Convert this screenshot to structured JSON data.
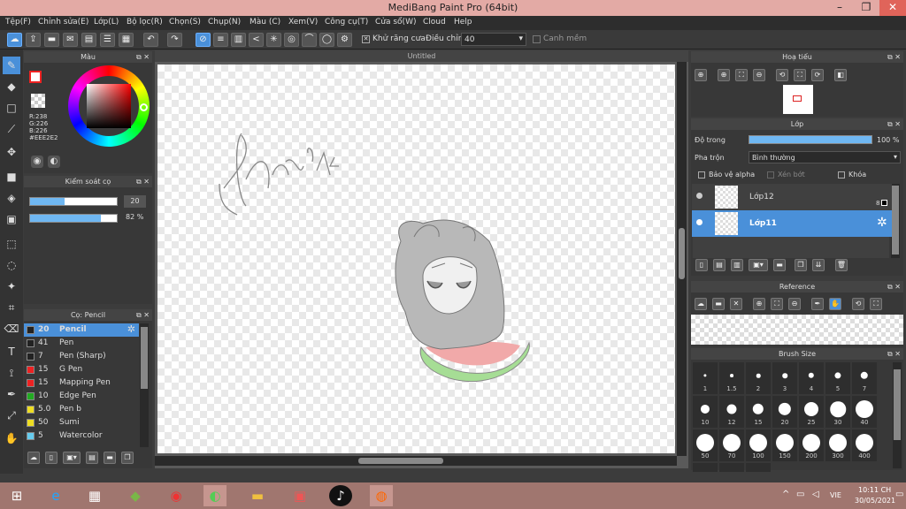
{
  "window": {
    "title": "MediBang Paint Pro (64bit)",
    "minimize": "–",
    "restore": "❐",
    "close": "✕"
  },
  "menu": [
    "Tệp(F)",
    "Chỉnh sửa(E)",
    "Lớp(L)",
    "Bộ lọc(R)",
    "Chọn(S)",
    "Chụp(N)",
    "Màu (C)",
    "Xem(V)",
    "Công cụ(T)",
    "Cửa sổ(W)",
    "Cloud",
    "Help"
  ],
  "toolbar": {
    "antialias_label": "Khử răng cưa",
    "correction_label": "Điều chỉnh",
    "correction_value": "40",
    "snap_label": "Canh mềm"
  },
  "color_panel": {
    "title": "Màu",
    "r": "R:238",
    "g": "G:226",
    "b": "B:226",
    "hex": "#EEE2E2",
    "primary_color": "#ee2222"
  },
  "brush_control": {
    "title": "Kiểm soát cọ",
    "size_value": "20",
    "size_fraction": 0.4,
    "opacity_value": "82 %",
    "opacity_fraction": 0.82
  },
  "brush_panel": {
    "title": "Cọ: Pencil",
    "items": [
      {
        "size": "20",
        "name": "Pencil",
        "color": "#222222"
      },
      {
        "size": "41",
        "name": "Pen",
        "color": "#222222"
      },
      {
        "size": "7",
        "name": "Pen (Sharp)",
        "color": "#222222"
      },
      {
        "size": "15",
        "name": "G Pen",
        "color": "#ee2222"
      },
      {
        "size": "15",
        "name": "Mapping Pen",
        "color": "#ee2222"
      },
      {
        "size": "10",
        "name": "Edge Pen",
        "color": "#22aa22"
      },
      {
        "size": "5.0",
        "name": "Pen b",
        "color": "#eedd22"
      },
      {
        "size": "50",
        "name": "Sumi",
        "color": "#eedd22"
      },
      {
        "size": "5",
        "name": "Watercolor",
        "color": "#66ccee"
      }
    ]
  },
  "canvas": {
    "tab_title": "Untitled"
  },
  "navigator": {
    "title": "Hoạ tiếu"
  },
  "layer_panel": {
    "title": "Lớp",
    "opacity_label": "Độ trong",
    "opacity_value": "100 %",
    "opacity_fraction": 1.0,
    "blend_label": "Pha trộn",
    "blend_value": "Bình thường",
    "protect_alpha": "Bảo vệ alpha",
    "clipping": "Xén bớt",
    "lock": "Khóa",
    "layers": [
      {
        "name": "Lớp12",
        "selected": false,
        "badge": "8"
      },
      {
        "name": "Lớp11",
        "selected": true,
        "badge": ""
      }
    ]
  },
  "reference_panel": {
    "title": "Reference"
  },
  "brush_size_panel": {
    "title": "Brush Size",
    "sizes": [
      "1",
      "1.5",
      "2",
      "3",
      "4",
      "5",
      "7",
      "10",
      "12",
      "15",
      "20",
      "25",
      "30",
      "40",
      "50",
      "70",
      "100",
      "150",
      "200",
      "300",
      "400"
    ]
  },
  "taskbar": {
    "lang": "VIE",
    "time": "10:11 CH",
    "date": "30/05/2021"
  },
  "colors": {
    "accent": "#4a90d9",
    "selected_row": "#4a90d9",
    "taskbar": "#a0766f"
  }
}
